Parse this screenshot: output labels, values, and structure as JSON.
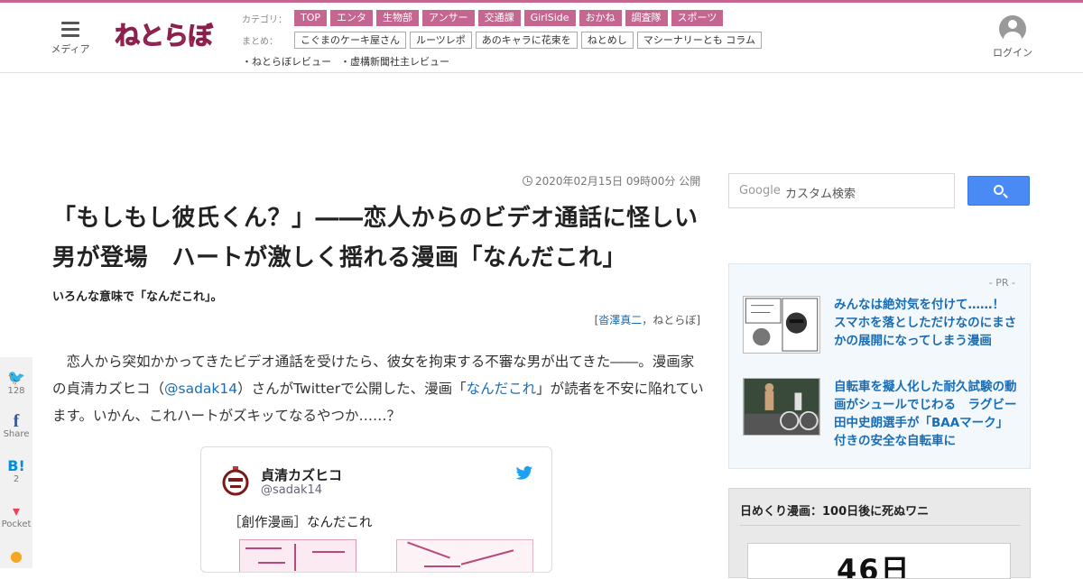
{
  "header": {
    "menu_label": "メディア",
    "logo_text": "ねとらぼ",
    "category_label": "カテゴリ：",
    "categories": [
      "TOP",
      "エンタ",
      "生物部",
      "アンサー",
      "交通課",
      "GirlSide",
      "おかね",
      "調査隊",
      "スポーツ"
    ],
    "summary_label": "まとめ：",
    "summaries": [
      "こぐまのケーキ屋さん",
      "ルーツレポ",
      "あのキャラに花束を",
      "ねとめし",
      "マシーナリーとも コラム"
    ],
    "reviews": [
      "・ねとらぼレビュー",
      "・虚構新聞社主レビュー"
    ],
    "login_label": "ログイン"
  },
  "article": {
    "date": "2020年02月15日 09時00分 公開",
    "title": "「もしもし彼氏くん？」――恋人からのビデオ通話に怪しい男が登場　ハートが激しく揺れる漫画「なんだこれ」",
    "subtitle": "いろんな意味で「なんだこれ」。",
    "byline_open": "[",
    "author": "沓澤真二",
    "byline_sep": "，",
    "outlet": "ねとらぼ",
    "byline_close": "]",
    "body_1": "　恋人から突如かかってきたビデオ通話を受けたら、彼女を拘束する不審な男が出てきた――。漫画家の貞清カズヒコ（",
    "body_link_handle": "@sadak14",
    "body_2": "）さんがTwitterで公開した、漫画「",
    "body_link_title": "なんだこれ",
    "body_3": "」が読者を不安に陥れています。いかん、これハートがズキッてなるやつか……？"
  },
  "share": [
    {
      "icon": "twitter-icon",
      "glyph": "🐦",
      "label": "128"
    },
    {
      "icon": "facebook-icon",
      "glyph": "f",
      "label": "Share"
    },
    {
      "icon": "hatena-icon",
      "glyph": "B!",
      "label": "2"
    },
    {
      "icon": "pocket-icon",
      "glyph": "▾",
      "label": "Pocket"
    },
    {
      "icon": "line-icon",
      "glyph": "●",
      "label": ""
    }
  ],
  "tweet": {
    "name": "貞清カズヒコ",
    "handle": "@sadak14",
    "text": "［創作漫画］なんだこれ"
  },
  "sidebar": {
    "search_brand": "Google",
    "search_placeholder": "カスタム検索",
    "pr_label": "- PR -",
    "pr_items": [
      {
        "title": "みんなは絶対気を付けて……！　スマホを落としただけなのにまさかの展開になってしまう漫画"
      },
      {
        "title": "自転車を擬人化した耐久試験の動画がシュールでじわる　ラグビー田中史朗選手が「BAAマーク」付きの安全な自転車に"
      }
    ],
    "manga_heading": "日めくり漫画：100日後に死ぬワニ",
    "manga_big": "46日"
  },
  "colors": {
    "accent": "#c4668f",
    "link": "#1a6db5",
    "search_button": "#4a8af4"
  }
}
